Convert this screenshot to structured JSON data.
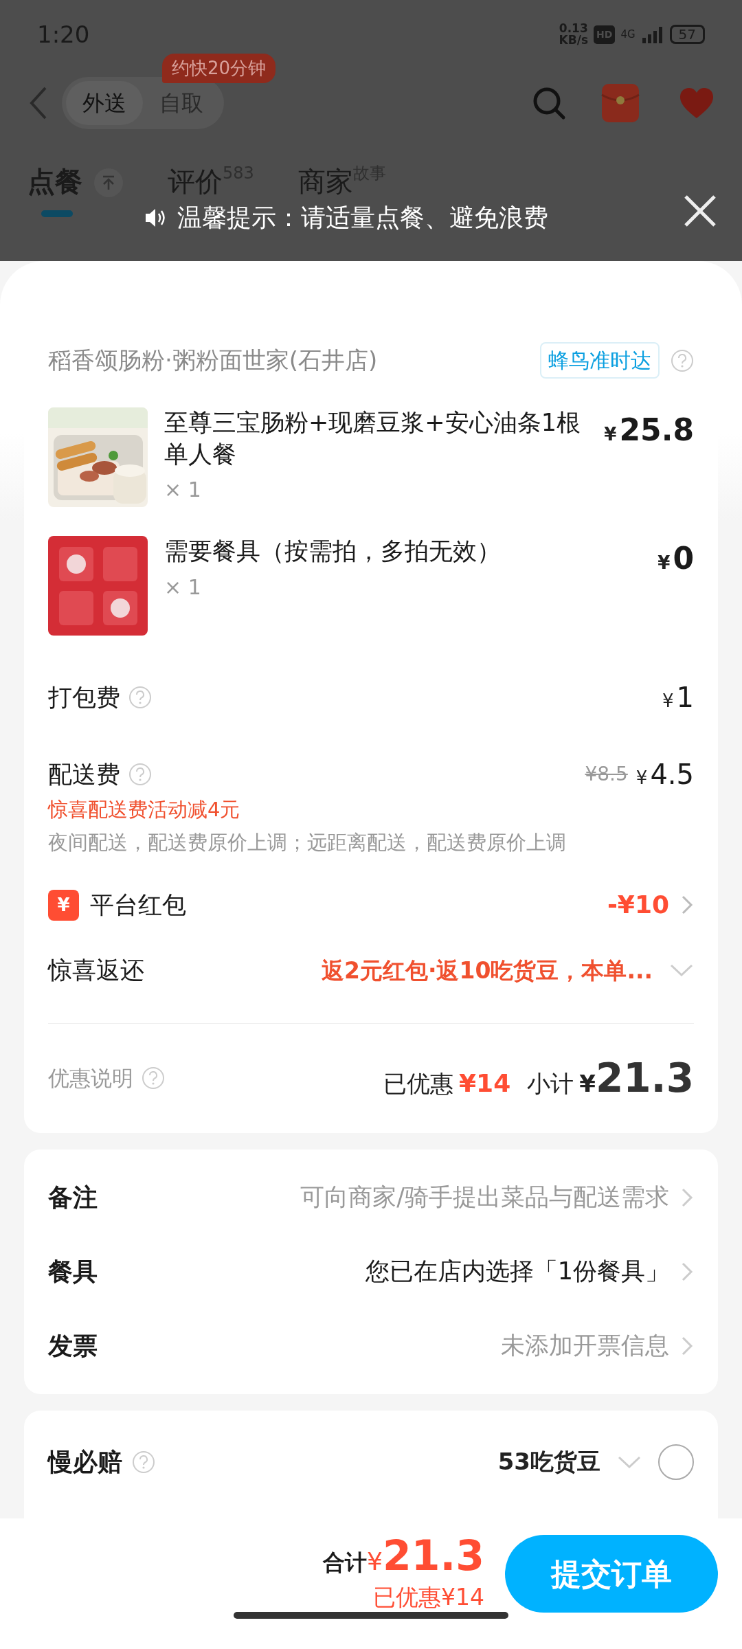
{
  "status_bar": {
    "time": "1:20",
    "net_speed": "0.13",
    "net_unit": "KB/s",
    "hd": "HD",
    "network": "4G",
    "battery": "57"
  },
  "nav": {
    "eta_badge": "约快20分钟",
    "modes": [
      {
        "label": "外送",
        "selected": true
      },
      {
        "label": "自取",
        "selected": false
      }
    ]
  },
  "tabs": [
    {
      "label": "点餐",
      "selected": true
    },
    {
      "label": "评价",
      "sup": "583",
      "selected": false
    },
    {
      "label": "商家",
      "sup": "故事",
      "selected": false
    }
  ],
  "toast": {
    "text": "温馨提示：请适量点餐、避免浪费"
  },
  "order": {
    "store": "稻香颂肠粉·粥粉面世家(石井店)",
    "delivery_badge": "蜂鸟准时达",
    "items": [
      {
        "name": "至尊三宝肠粉+现磨豆浆+安心油条1根单人餐",
        "qty": "× 1",
        "currency": "¥",
        "amount": "25.8",
        "kind": "picture"
      },
      {
        "name": "需要餐具（按需拍，多拍无效）",
        "qty": "× 1",
        "currency": "¥",
        "amount": "0",
        "kind": "picture"
      }
    ],
    "packing_fee": {
      "label": "打包费",
      "currency": "¥",
      "amount": "1"
    },
    "delivery_fee": {
      "label": "配送费",
      "original": "¥8.5",
      "currency": "¥",
      "amount": "4.5",
      "promo": "惊喜配送费活动减4元",
      "note": "夜间配送，配送费原价上调；远距离配送，配送费原价上调"
    },
    "platform_coupon": {
      "icon": "¥",
      "label": "平台红包",
      "value": "-¥10"
    },
    "cashback": {
      "label": "惊喜返还",
      "value": "返2元红包·返10吃货豆，本单..."
    },
    "summary": {
      "label": "优惠说明",
      "saved_label": "已优惠",
      "saved": "¥14",
      "subtotal_label": "小计",
      "currency": "¥",
      "subtotal": "21.3"
    }
  },
  "options": [
    {
      "label": "备注",
      "value": "可向商家/骑手提出菜品与配送需求",
      "placeholder": true
    },
    {
      "label": "餐具",
      "value": "您已在店内选择「1份餐具」",
      "placeholder": false
    },
    {
      "label": "发票",
      "value": "未添加开票信息",
      "placeholder": true
    }
  ],
  "guarantee": {
    "label": "慢必赔",
    "price": "53吃货豆",
    "checked": false
  },
  "bottom_bar": {
    "total_label": "合计",
    "currency": "¥",
    "total": "21.3",
    "saved": "已优惠¥14",
    "submit": "提交订单"
  }
}
